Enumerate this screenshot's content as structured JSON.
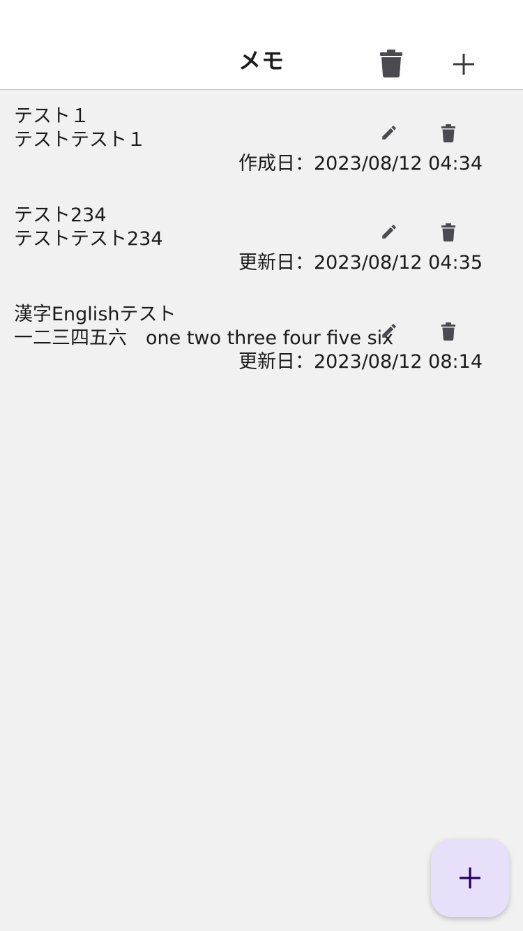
{
  "appbar": {
    "title": "メモ",
    "delete_all_icon": "delete-icon",
    "add_icon": "plus-icon"
  },
  "memos": [
    {
      "title": "テスト１",
      "body": "テストテスト１",
      "date": "作成日：2023/08/12 04:34"
    },
    {
      "title": "テスト234",
      "body": "テストテスト234",
      "date": "更新日：2023/08/12 04:35"
    },
    {
      "title": "漢字Englishテスト",
      "body": "一二三四五六　one two three four five six",
      "date": "更新日：2023/08/12 08:14"
    }
  ],
  "fab": {
    "icon": "plus-icon"
  },
  "colors": {
    "appbar_bg": "#ffffff",
    "background": "#f1f1f1",
    "icon": "#4a4a50",
    "fab_bg": "#e8dffb",
    "fab_icon": "#21005d"
  }
}
